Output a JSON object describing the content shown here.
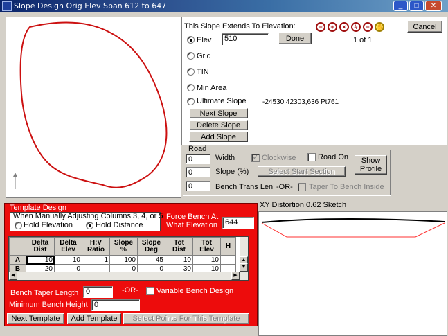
{
  "window": {
    "title": "Slope Design Orig Elev Span 612 to 647",
    "min_label": "_",
    "max_label": "□",
    "close_label": "✕"
  },
  "top": {
    "extends_label": "This Slope Extends To Elevation:",
    "elev_label": "Elev",
    "elev_value": "510",
    "done_label": "Done",
    "page_indicator": "1 of 1",
    "cancel_label": "Cancel",
    "grid_label": "Grid",
    "tin_label": "TIN",
    "min_area_label": "Min Area",
    "ultimate_label": "Ultimate Slope",
    "ultimate_value": "-24530,42303,636 Pt761",
    "next_slope_label": "Next Slope",
    "delete_slope_label": "Delete Slope",
    "add_slope_label": "Add Slope"
  },
  "road": {
    "group_label": "Road",
    "width_value": "0",
    "width_label": "Width",
    "clockwise_label": "Clockwise",
    "road_on_label": "Road On",
    "show_profile_label": "Show Profile",
    "slope_value": "0",
    "slope_label": "Slope (%)",
    "select_start_label": "Select Start Section",
    "bench_value": "0",
    "bench_label": "Bench Trans Len",
    "or_label": "-OR-",
    "taper_label": "Taper To Bench Inside"
  },
  "template": {
    "group_label": "Template Design",
    "adjust_label": "When Manually Adjusting Columns 3, 4, or 5",
    "hold_elev_label": "Hold Elevation",
    "hold_dist_label": "Hold Distance",
    "force_bench_label": "Force Bench At What Elevation",
    "force_bench_value": "644",
    "columns": [
      "Delta Dist",
      "Delta Elev",
      "H:V Ratio",
      "Slope %",
      "Slope Deg",
      "Tot Dist",
      "Tot Elev",
      "H"
    ],
    "rows": [
      {
        "label": "A",
        "cells": [
          "10",
          "10",
          "1",
          "100",
          "45",
          "10",
          "10"
        ]
      },
      {
        "label": "B",
        "cells": [
          "20",
          "0",
          "",
          "0",
          "0",
          "30",
          "10"
        ]
      }
    ],
    "bench_taper_label": "Bench Taper Length",
    "bench_taper_value": "0",
    "or_label": "-OR-",
    "variable_bench_label": "Variable Bench Design",
    "min_bench_label": "Minimum Bench Height",
    "min_bench_value": "0",
    "next_template_label": "Next Template",
    "add_template_label": "Add Template",
    "select_points_label": "Select Points For This Template"
  },
  "sketch": {
    "label": "XY Distortion 0.62 Sketch"
  },
  "colors": {
    "template_bg": "#ed0c0c",
    "outline_red": "#cc1010",
    "title_blue": "#0a246a"
  }
}
